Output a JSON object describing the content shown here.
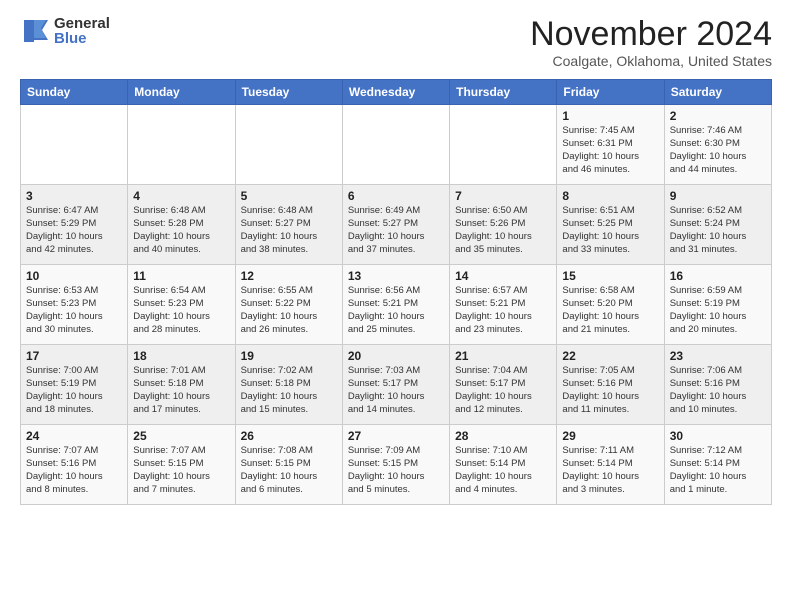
{
  "header": {
    "logo_general": "General",
    "logo_blue": "Blue",
    "month_title": "November 2024",
    "subtitle": "Coalgate, Oklahoma, United States"
  },
  "calendar": {
    "days_of_week": [
      "Sunday",
      "Monday",
      "Tuesday",
      "Wednesday",
      "Thursday",
      "Friday",
      "Saturday"
    ],
    "weeks": [
      [
        {
          "day": "",
          "content": ""
        },
        {
          "day": "",
          "content": ""
        },
        {
          "day": "",
          "content": ""
        },
        {
          "day": "",
          "content": ""
        },
        {
          "day": "",
          "content": ""
        },
        {
          "day": "1",
          "content": "Sunrise: 7:45 AM\nSunset: 6:31 PM\nDaylight: 10 hours\nand 46 minutes."
        },
        {
          "day": "2",
          "content": "Sunrise: 7:46 AM\nSunset: 6:30 PM\nDaylight: 10 hours\nand 44 minutes."
        }
      ],
      [
        {
          "day": "3",
          "content": "Sunrise: 6:47 AM\nSunset: 5:29 PM\nDaylight: 10 hours\nand 42 minutes."
        },
        {
          "day": "4",
          "content": "Sunrise: 6:48 AM\nSunset: 5:28 PM\nDaylight: 10 hours\nand 40 minutes."
        },
        {
          "day": "5",
          "content": "Sunrise: 6:48 AM\nSunset: 5:27 PM\nDaylight: 10 hours\nand 38 minutes."
        },
        {
          "day": "6",
          "content": "Sunrise: 6:49 AM\nSunset: 5:27 PM\nDaylight: 10 hours\nand 37 minutes."
        },
        {
          "day": "7",
          "content": "Sunrise: 6:50 AM\nSunset: 5:26 PM\nDaylight: 10 hours\nand 35 minutes."
        },
        {
          "day": "8",
          "content": "Sunrise: 6:51 AM\nSunset: 5:25 PM\nDaylight: 10 hours\nand 33 minutes."
        },
        {
          "day": "9",
          "content": "Sunrise: 6:52 AM\nSunset: 5:24 PM\nDaylight: 10 hours\nand 31 minutes."
        }
      ],
      [
        {
          "day": "10",
          "content": "Sunrise: 6:53 AM\nSunset: 5:23 PM\nDaylight: 10 hours\nand 30 minutes."
        },
        {
          "day": "11",
          "content": "Sunrise: 6:54 AM\nSunset: 5:23 PM\nDaylight: 10 hours\nand 28 minutes."
        },
        {
          "day": "12",
          "content": "Sunrise: 6:55 AM\nSunset: 5:22 PM\nDaylight: 10 hours\nand 26 minutes."
        },
        {
          "day": "13",
          "content": "Sunrise: 6:56 AM\nSunset: 5:21 PM\nDaylight: 10 hours\nand 25 minutes."
        },
        {
          "day": "14",
          "content": "Sunrise: 6:57 AM\nSunset: 5:21 PM\nDaylight: 10 hours\nand 23 minutes."
        },
        {
          "day": "15",
          "content": "Sunrise: 6:58 AM\nSunset: 5:20 PM\nDaylight: 10 hours\nand 21 minutes."
        },
        {
          "day": "16",
          "content": "Sunrise: 6:59 AM\nSunset: 5:19 PM\nDaylight: 10 hours\nand 20 minutes."
        }
      ],
      [
        {
          "day": "17",
          "content": "Sunrise: 7:00 AM\nSunset: 5:19 PM\nDaylight: 10 hours\nand 18 minutes."
        },
        {
          "day": "18",
          "content": "Sunrise: 7:01 AM\nSunset: 5:18 PM\nDaylight: 10 hours\nand 17 minutes."
        },
        {
          "day": "19",
          "content": "Sunrise: 7:02 AM\nSunset: 5:18 PM\nDaylight: 10 hours\nand 15 minutes."
        },
        {
          "day": "20",
          "content": "Sunrise: 7:03 AM\nSunset: 5:17 PM\nDaylight: 10 hours\nand 14 minutes."
        },
        {
          "day": "21",
          "content": "Sunrise: 7:04 AM\nSunset: 5:17 PM\nDaylight: 10 hours\nand 12 minutes."
        },
        {
          "day": "22",
          "content": "Sunrise: 7:05 AM\nSunset: 5:16 PM\nDaylight: 10 hours\nand 11 minutes."
        },
        {
          "day": "23",
          "content": "Sunrise: 7:06 AM\nSunset: 5:16 PM\nDaylight: 10 hours\nand 10 minutes."
        }
      ],
      [
        {
          "day": "24",
          "content": "Sunrise: 7:07 AM\nSunset: 5:16 PM\nDaylight: 10 hours\nand 8 minutes."
        },
        {
          "day": "25",
          "content": "Sunrise: 7:07 AM\nSunset: 5:15 PM\nDaylight: 10 hours\nand 7 minutes."
        },
        {
          "day": "26",
          "content": "Sunrise: 7:08 AM\nSunset: 5:15 PM\nDaylight: 10 hours\nand 6 minutes."
        },
        {
          "day": "27",
          "content": "Sunrise: 7:09 AM\nSunset: 5:15 PM\nDaylight: 10 hours\nand 5 minutes."
        },
        {
          "day": "28",
          "content": "Sunrise: 7:10 AM\nSunset: 5:14 PM\nDaylight: 10 hours\nand 4 minutes."
        },
        {
          "day": "29",
          "content": "Sunrise: 7:11 AM\nSunset: 5:14 PM\nDaylight: 10 hours\nand 3 minutes."
        },
        {
          "day": "30",
          "content": "Sunrise: 7:12 AM\nSunset: 5:14 PM\nDaylight: 10 hours\nand 1 minute."
        }
      ]
    ]
  }
}
